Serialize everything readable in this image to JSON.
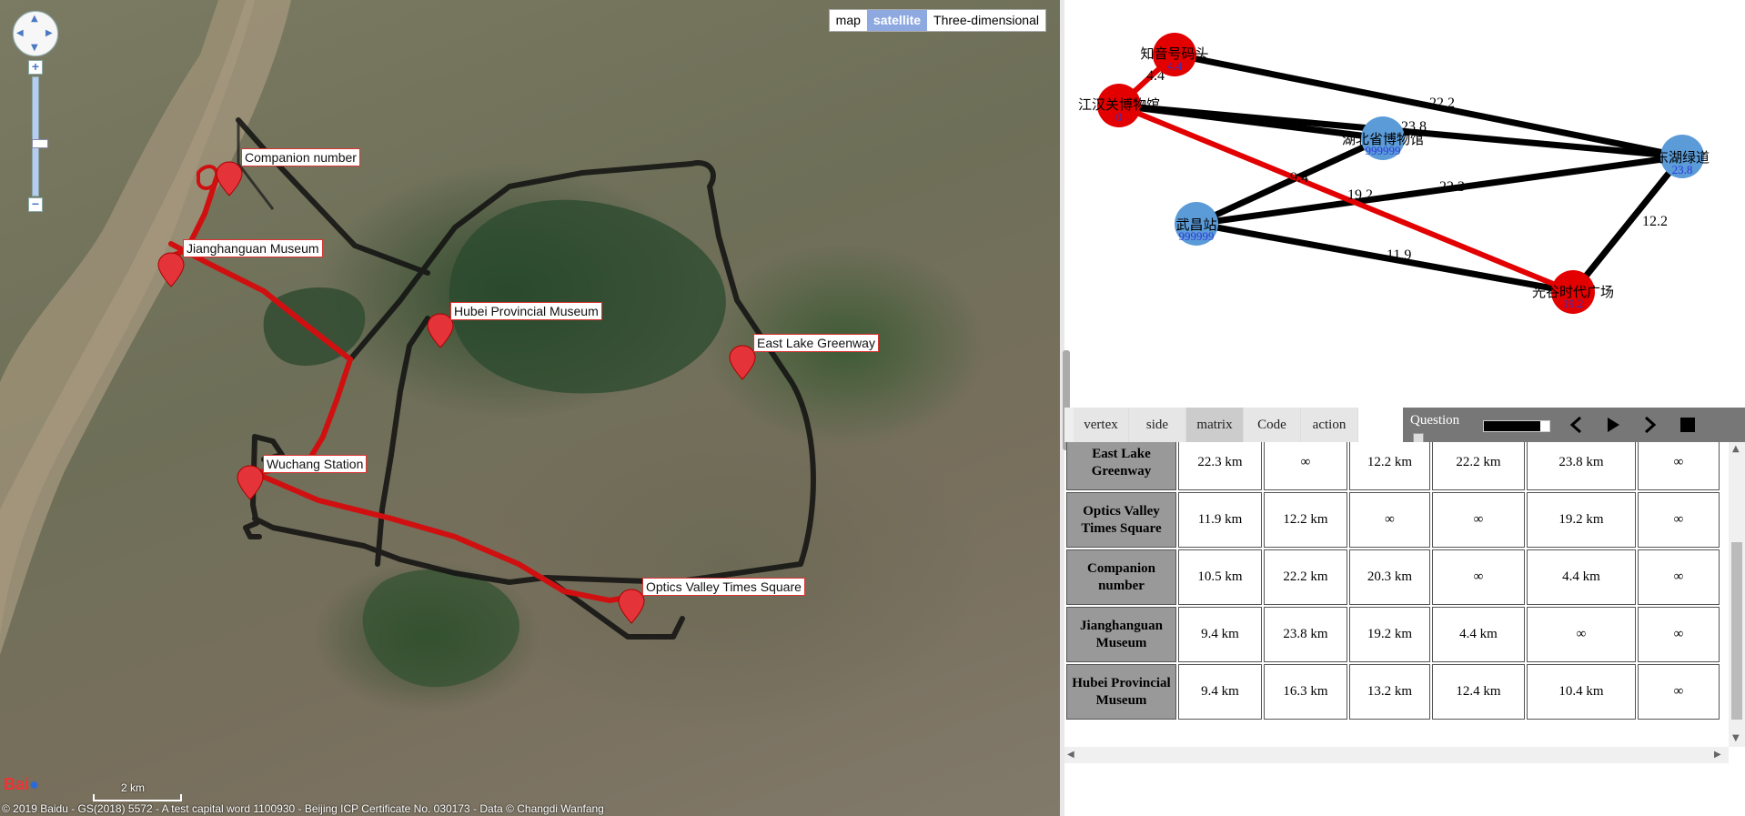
{
  "map": {
    "mode_buttons": [
      "map",
      "satellite",
      "Three-dimensional"
    ],
    "active_mode": "satellite",
    "labels": {
      "companion": "Companion number",
      "jianghanguan": "Jianghanguan Museum",
      "hubei": "Hubei Provincial Museum",
      "eastlake": "East Lake Greenway",
      "wuchang": "Wuchang Station",
      "optics": "Optics Valley Times Square"
    },
    "logo": "Bai",
    "scale_label": "2 km",
    "copyright": "© 2019 Baidu - GS(2018) 5572 - A test capital word 1100930 - Beijing ICP Certificate No. 030173 - Data © Changdi Wanfang"
  },
  "graph": {
    "nodes": {
      "zhiyin": {
        "name": "知音号码头",
        "value": "4.4"
      },
      "jhg": {
        "name": "江汉关博物馆",
        "value": "0"
      },
      "hubei": {
        "name": "湖北省博物馆",
        "value": "999999"
      },
      "donghu": {
        "name": "东湖绿道",
        "value": "23.8"
      },
      "wuchang": {
        "name": "武昌站",
        "value": "999999"
      },
      "guanggu": {
        "name": "光谷时代广场",
        "value": "19.2"
      }
    },
    "edges": {
      "e_zj": "4.4",
      "e_zd": "22.2",
      "e_jh": "23.8",
      "e_wh": "9.4",
      "e_jg": "19.2",
      "e_wd": "22.3",
      "e_wg": "11.9",
      "e_dg": "12.2"
    }
  },
  "toolbar": {
    "tabs": [
      "vertex",
      "side",
      "matrix",
      "Code",
      "action"
    ],
    "active_tab": "matrix",
    "question_label": "Question"
  },
  "matrix": {
    "rows": [
      {
        "name": "East Lake Greenway",
        "cells": [
          "22.3 km",
          "∞",
          "12.2 km",
          "22.2 km",
          "23.8 km",
          "∞"
        ]
      },
      {
        "name": "Optics Valley Times Square",
        "cells": [
          "11.9 km",
          "12.2 km",
          "∞",
          "∞",
          "19.2 km",
          "∞"
        ]
      },
      {
        "name": "Companion number",
        "cells": [
          "10.5 km",
          "22.2 km",
          "20.3 km",
          "∞",
          "4.4 km",
          "∞"
        ]
      },
      {
        "name": "Jianghanguan Museum",
        "cells": [
          "9.4 km",
          "23.8 km",
          "19.2 km",
          "4.4 km",
          "∞",
          "∞"
        ]
      },
      {
        "name": "Hubei Provincial Museum",
        "cells": [
          "9.4 km",
          "16.3 km",
          "13.2 km",
          "12.4 km",
          "10.4 km",
          "∞"
        ]
      }
    ]
  },
  "colors": {
    "visited_node": "#e20000",
    "unvisited_node": "#5b9bd8",
    "active_route": "#d01010",
    "route": "#111111"
  }
}
